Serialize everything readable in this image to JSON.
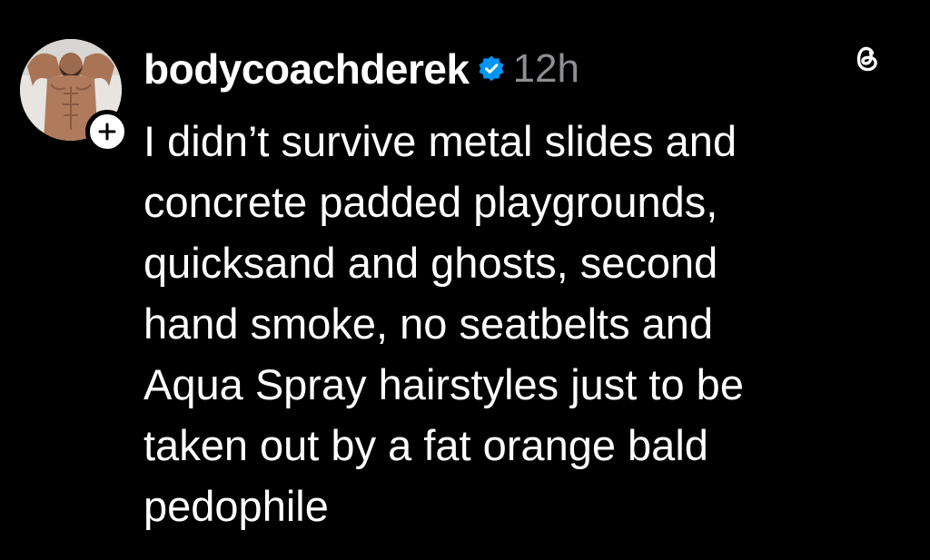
{
  "post": {
    "author": {
      "username": "bodycoachderek",
      "verified": true,
      "avatar_icon": "avatar-photo"
    },
    "timestamp": "12h",
    "platform_icon": "threads-logo-icon",
    "follow_icon": "plus-icon",
    "text_lines": [
      "I didn’t survive metal slides and",
      "concrete padded playgrounds,",
      "quicksand and ghosts, second",
      "hand smoke, no seatbelts and",
      "Aqua Spray hairstyles just to be",
      "taken out by a fat orange bald",
      "pedophile"
    ]
  },
  "colors": {
    "background": "#000000",
    "text": "#ffffff",
    "muted": "#8e8e93",
    "verified_blue": "#0095f6"
  }
}
